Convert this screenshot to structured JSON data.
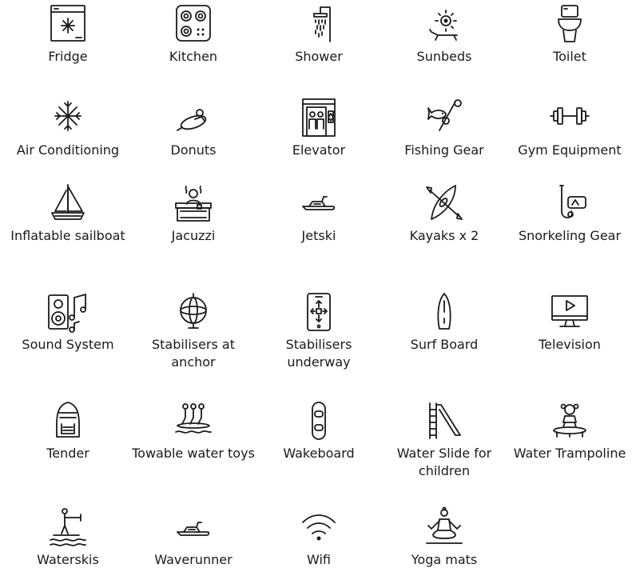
{
  "amenities": [
    {
      "label": "Fridge",
      "icon": "fridge-icon"
    },
    {
      "label": "Kitchen",
      "icon": "kitchen-icon"
    },
    {
      "label": "Shower",
      "icon": "shower-icon"
    },
    {
      "label": "Sunbeds",
      "icon": "sunbed-icon"
    },
    {
      "label": "Toilet",
      "icon": "toilet-icon"
    },
    {
      "label": "Air Conditioning",
      "icon": "snowflake-icon"
    },
    {
      "label": "Donuts",
      "icon": "donut-tube-icon"
    },
    {
      "label": "Elevator",
      "icon": "elevator-icon"
    },
    {
      "label": "Fishing Gear",
      "icon": "fishing-gear-icon"
    },
    {
      "label": "Gym Equipment",
      "icon": "dumbbell-icon"
    },
    {
      "label": "Inflatable sailboat",
      "icon": "sailboat-icon"
    },
    {
      "label": "Jacuzzi",
      "icon": "jacuzzi-icon"
    },
    {
      "label": "Jetski",
      "icon": "jetski-icon"
    },
    {
      "label": "Kayaks x 2",
      "icon": "kayak-icon"
    },
    {
      "label": "Snorkeling Gear",
      "icon": "snorkel-icon"
    },
    {
      "label": "Sound System",
      "icon": "speaker-icon"
    },
    {
      "label": "Stabilisers at anchor",
      "icon": "gyroscope-icon"
    },
    {
      "label": "Stabilisers underway",
      "icon": "phone-stabiliser-icon"
    },
    {
      "label": "Surf Board",
      "icon": "surfboard-icon"
    },
    {
      "label": "Television",
      "icon": "monitor-icon"
    },
    {
      "label": "Tender",
      "icon": "tender-boat-icon"
    },
    {
      "label": "Towable water toys",
      "icon": "towable-toys-icon"
    },
    {
      "label": "Wakeboard",
      "icon": "wakeboard-icon"
    },
    {
      "label": "Water Slide for children",
      "icon": "water-slide-icon"
    },
    {
      "label": "Water Trampoline",
      "icon": "trampoline-icon"
    },
    {
      "label": "Waterskis",
      "icon": "waterski-icon"
    },
    {
      "label": "Waverunner",
      "icon": "waverunner-icon"
    },
    {
      "label": "Wifi",
      "icon": "wifi-icon"
    },
    {
      "label": "Yoga mats",
      "icon": "yoga-icon"
    }
  ]
}
